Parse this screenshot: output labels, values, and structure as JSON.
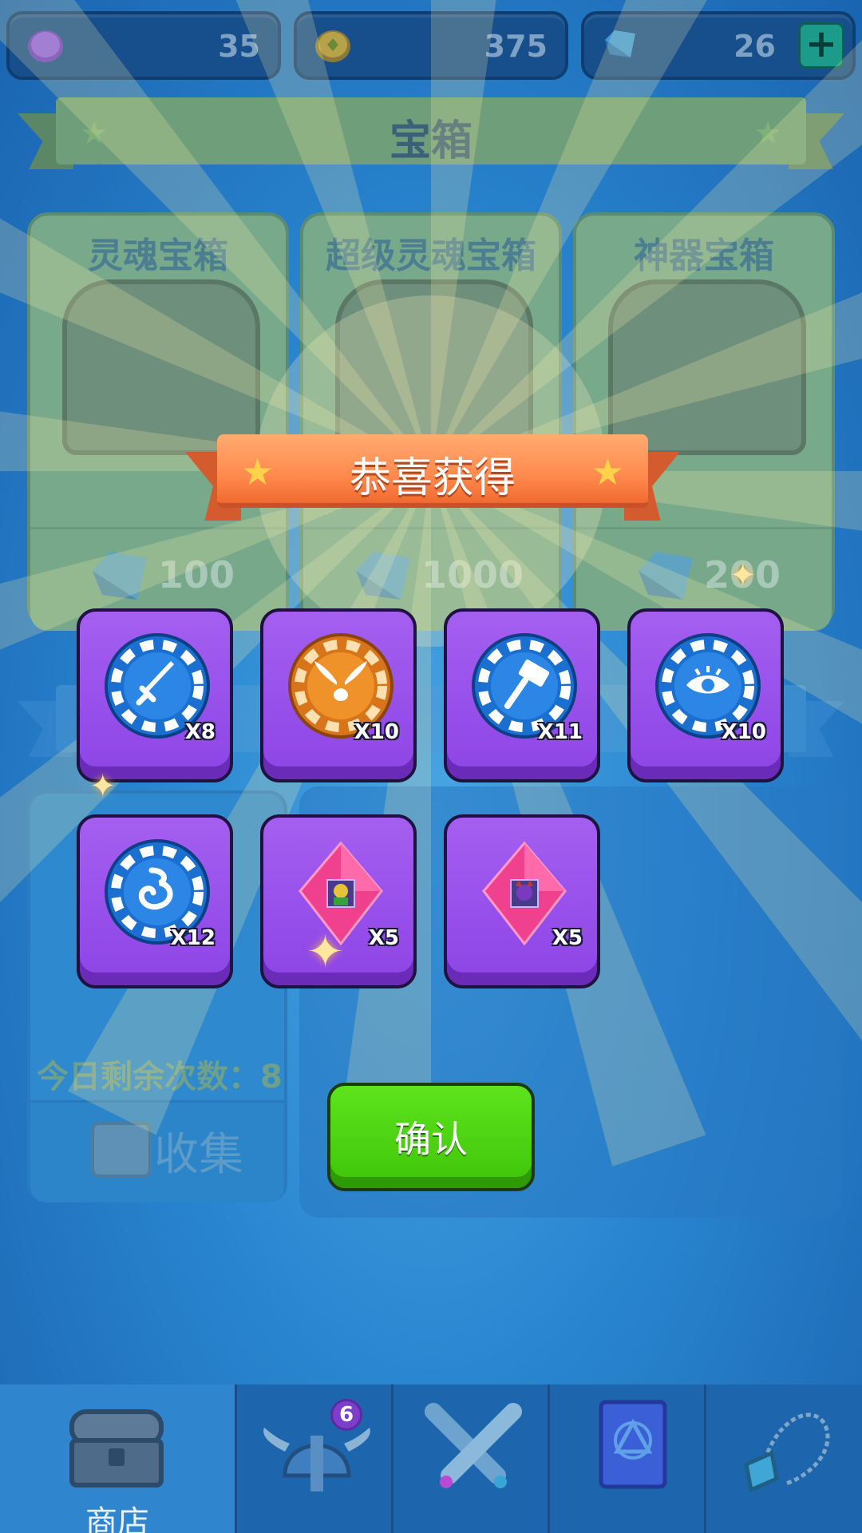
{
  "currencies": [
    {
      "name": "purple-coin",
      "value": "35",
      "color": "#7a4fd6"
    },
    {
      "name": "gold-coin",
      "value": "375",
      "color": "#c9a33a"
    },
    {
      "name": "gem",
      "value": "26",
      "color": "#3aa0e8"
    }
  ],
  "add_button_label": "+",
  "section_title": "宝箱",
  "chests": [
    {
      "name": "灵魂宝箱",
      "price": "100"
    },
    {
      "name": "超级灵魂宝箱",
      "price": "1000"
    },
    {
      "name": "神器宝箱",
      "price": "200"
    }
  ],
  "lower_panel": {
    "remaining_label": "今日剩余次数：",
    "remaining_value": "8",
    "collect_label": "收集"
  },
  "reward_popup": {
    "title": "恭喜获得",
    "rewards": [
      {
        "icon": "sword-token-icon",
        "token": "blue",
        "qty": "X8"
      },
      {
        "icon": "winged-helmet-token-icon",
        "token": "orange",
        "qty": "X10"
      },
      {
        "icon": "hammer-token-icon",
        "token": "blue",
        "qty": "X11"
      },
      {
        "icon": "eye-token-icon",
        "token": "blue",
        "qty": "X10"
      },
      {
        "icon": "spirit-token-icon",
        "token": "blue",
        "qty": "X12"
      },
      {
        "icon": "hero-shard-gold-icon",
        "token": "pink",
        "qty": "X5"
      },
      {
        "icon": "hero-shard-demon-icon",
        "token": "pink",
        "qty": "X5"
      }
    ],
    "confirm_label": "确认"
  },
  "nav": {
    "items": [
      {
        "label": "商店",
        "icon": "chest-icon",
        "active": true
      },
      {
        "label": "",
        "icon": "helmet-icon",
        "badge": "6"
      },
      {
        "label": "",
        "icon": "crossed-swords-icon"
      },
      {
        "label": "",
        "icon": "spellbook-icon"
      },
      {
        "label": "",
        "icon": "amulet-icon"
      }
    ]
  }
}
